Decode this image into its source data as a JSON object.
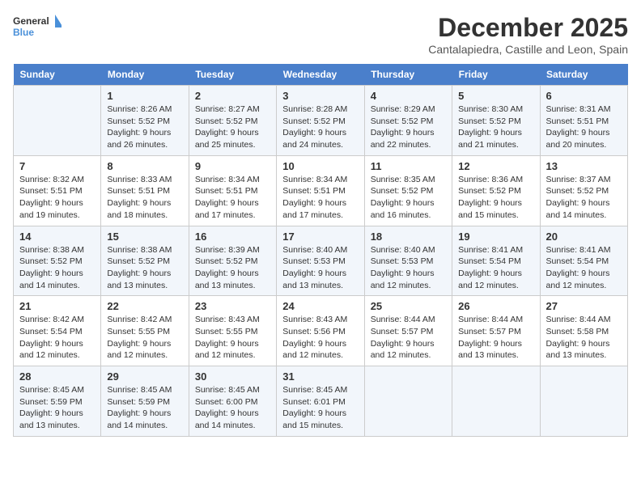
{
  "logo": {
    "line1": "General",
    "line2": "Blue"
  },
  "title": "December 2025",
  "subtitle": "Cantalapiedra, Castille and Leon, Spain",
  "weekdays": [
    "Sunday",
    "Monday",
    "Tuesday",
    "Wednesday",
    "Thursday",
    "Friday",
    "Saturday"
  ],
  "weeks": [
    [
      {
        "day": "",
        "info": ""
      },
      {
        "day": "1",
        "info": "Sunrise: 8:26 AM\nSunset: 5:52 PM\nDaylight: 9 hours\nand 26 minutes."
      },
      {
        "day": "2",
        "info": "Sunrise: 8:27 AM\nSunset: 5:52 PM\nDaylight: 9 hours\nand 25 minutes."
      },
      {
        "day": "3",
        "info": "Sunrise: 8:28 AM\nSunset: 5:52 PM\nDaylight: 9 hours\nand 24 minutes."
      },
      {
        "day": "4",
        "info": "Sunrise: 8:29 AM\nSunset: 5:52 PM\nDaylight: 9 hours\nand 22 minutes."
      },
      {
        "day": "5",
        "info": "Sunrise: 8:30 AM\nSunset: 5:52 PM\nDaylight: 9 hours\nand 21 minutes."
      },
      {
        "day": "6",
        "info": "Sunrise: 8:31 AM\nSunset: 5:51 PM\nDaylight: 9 hours\nand 20 minutes."
      }
    ],
    [
      {
        "day": "7",
        "info": "Sunrise: 8:32 AM\nSunset: 5:51 PM\nDaylight: 9 hours\nand 19 minutes."
      },
      {
        "day": "8",
        "info": "Sunrise: 8:33 AM\nSunset: 5:51 PM\nDaylight: 9 hours\nand 18 minutes."
      },
      {
        "day": "9",
        "info": "Sunrise: 8:34 AM\nSunset: 5:51 PM\nDaylight: 9 hours\nand 17 minutes."
      },
      {
        "day": "10",
        "info": "Sunrise: 8:34 AM\nSunset: 5:51 PM\nDaylight: 9 hours\nand 17 minutes."
      },
      {
        "day": "11",
        "info": "Sunrise: 8:35 AM\nSunset: 5:52 PM\nDaylight: 9 hours\nand 16 minutes."
      },
      {
        "day": "12",
        "info": "Sunrise: 8:36 AM\nSunset: 5:52 PM\nDaylight: 9 hours\nand 15 minutes."
      },
      {
        "day": "13",
        "info": "Sunrise: 8:37 AM\nSunset: 5:52 PM\nDaylight: 9 hours\nand 14 minutes."
      }
    ],
    [
      {
        "day": "14",
        "info": "Sunrise: 8:38 AM\nSunset: 5:52 PM\nDaylight: 9 hours\nand 14 minutes."
      },
      {
        "day": "15",
        "info": "Sunrise: 8:38 AM\nSunset: 5:52 PM\nDaylight: 9 hours\nand 13 minutes."
      },
      {
        "day": "16",
        "info": "Sunrise: 8:39 AM\nSunset: 5:52 PM\nDaylight: 9 hours\nand 13 minutes."
      },
      {
        "day": "17",
        "info": "Sunrise: 8:40 AM\nSunset: 5:53 PM\nDaylight: 9 hours\nand 13 minutes."
      },
      {
        "day": "18",
        "info": "Sunrise: 8:40 AM\nSunset: 5:53 PM\nDaylight: 9 hours\nand 12 minutes."
      },
      {
        "day": "19",
        "info": "Sunrise: 8:41 AM\nSunset: 5:54 PM\nDaylight: 9 hours\nand 12 minutes."
      },
      {
        "day": "20",
        "info": "Sunrise: 8:41 AM\nSunset: 5:54 PM\nDaylight: 9 hours\nand 12 minutes."
      }
    ],
    [
      {
        "day": "21",
        "info": "Sunrise: 8:42 AM\nSunset: 5:54 PM\nDaylight: 9 hours\nand 12 minutes."
      },
      {
        "day": "22",
        "info": "Sunrise: 8:42 AM\nSunset: 5:55 PM\nDaylight: 9 hours\nand 12 minutes."
      },
      {
        "day": "23",
        "info": "Sunrise: 8:43 AM\nSunset: 5:55 PM\nDaylight: 9 hours\nand 12 minutes."
      },
      {
        "day": "24",
        "info": "Sunrise: 8:43 AM\nSunset: 5:56 PM\nDaylight: 9 hours\nand 12 minutes."
      },
      {
        "day": "25",
        "info": "Sunrise: 8:44 AM\nSunset: 5:57 PM\nDaylight: 9 hours\nand 12 minutes."
      },
      {
        "day": "26",
        "info": "Sunrise: 8:44 AM\nSunset: 5:57 PM\nDaylight: 9 hours\nand 13 minutes."
      },
      {
        "day": "27",
        "info": "Sunrise: 8:44 AM\nSunset: 5:58 PM\nDaylight: 9 hours\nand 13 minutes."
      }
    ],
    [
      {
        "day": "28",
        "info": "Sunrise: 8:45 AM\nSunset: 5:59 PM\nDaylight: 9 hours\nand 13 minutes."
      },
      {
        "day": "29",
        "info": "Sunrise: 8:45 AM\nSunset: 5:59 PM\nDaylight: 9 hours\nand 14 minutes."
      },
      {
        "day": "30",
        "info": "Sunrise: 8:45 AM\nSunset: 6:00 PM\nDaylight: 9 hours\nand 14 minutes."
      },
      {
        "day": "31",
        "info": "Sunrise: 8:45 AM\nSunset: 6:01 PM\nDaylight: 9 hours\nand 15 minutes."
      },
      {
        "day": "",
        "info": ""
      },
      {
        "day": "",
        "info": ""
      },
      {
        "day": "",
        "info": ""
      }
    ]
  ]
}
